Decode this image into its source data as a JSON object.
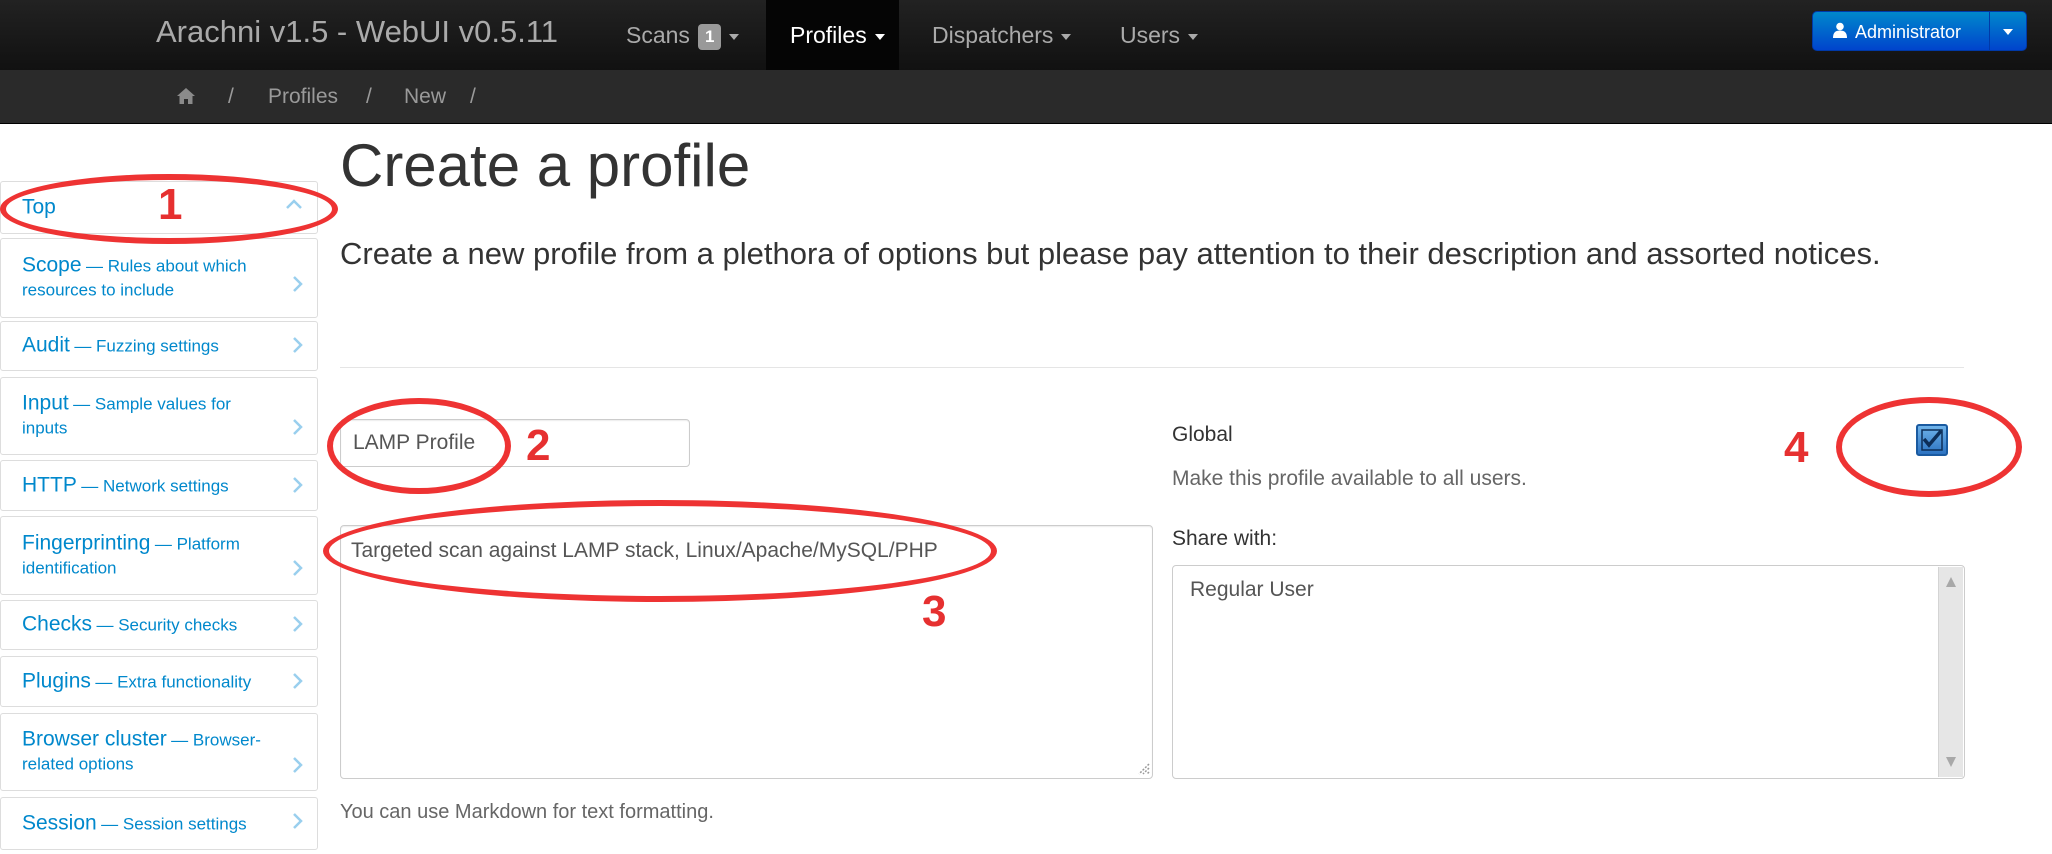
{
  "navbar": {
    "brand": "Arachni v1.5 - WebUI v0.5.11",
    "items": [
      {
        "label": "Scans",
        "badge": "1"
      },
      {
        "label": "Profiles"
      },
      {
        "label": "Dispatchers"
      },
      {
        "label": "Users"
      }
    ],
    "user_button": "Administrator"
  },
  "breadcrumb": {
    "home_icon": "home-icon",
    "separator": "/",
    "items": [
      "Profiles",
      "New"
    ]
  },
  "sidebar": {
    "items": [
      {
        "title": "Top",
        "desc": ""
      },
      {
        "title": "Scope",
        "desc": "— Rules about which resources to include"
      },
      {
        "title": "Audit",
        "desc": "— Fuzzing settings"
      },
      {
        "title": "Input",
        "desc": "— Sample values for inputs"
      },
      {
        "title": "HTTP",
        "desc": "— Network settings"
      },
      {
        "title": "Fingerprinting",
        "desc": "— Platform identification"
      },
      {
        "title": "Checks",
        "desc": "— Security checks"
      },
      {
        "title": "Plugins",
        "desc": "— Extra functionality"
      },
      {
        "title": "Browser cluster",
        "desc": "— Browser-related options"
      },
      {
        "title": "Session",
        "desc": "— Session settings"
      }
    ]
  },
  "main": {
    "title": "Create a profile",
    "lead": "Create a new profile from a plethora of options but please pay attention to their description and assorted notices.",
    "name_value": "LAMP Profile",
    "description_value": "Targeted scan against LAMP stack, Linux/Apache/MySQL/PHP",
    "markdown_help": "You can use Markdown for text formatting.",
    "global_label": "Global",
    "global_desc": "Make this profile available to all users.",
    "global_checked": true,
    "share_label": "Share with:",
    "share_options": [
      "Regular User"
    ]
  },
  "annotations": [
    "1",
    "2",
    "3",
    "4"
  ],
  "colors": {
    "link": "#0088cc",
    "annotation": "#ee3333",
    "navbar": "#1b1b1b",
    "primary_button": "#0066cc"
  }
}
